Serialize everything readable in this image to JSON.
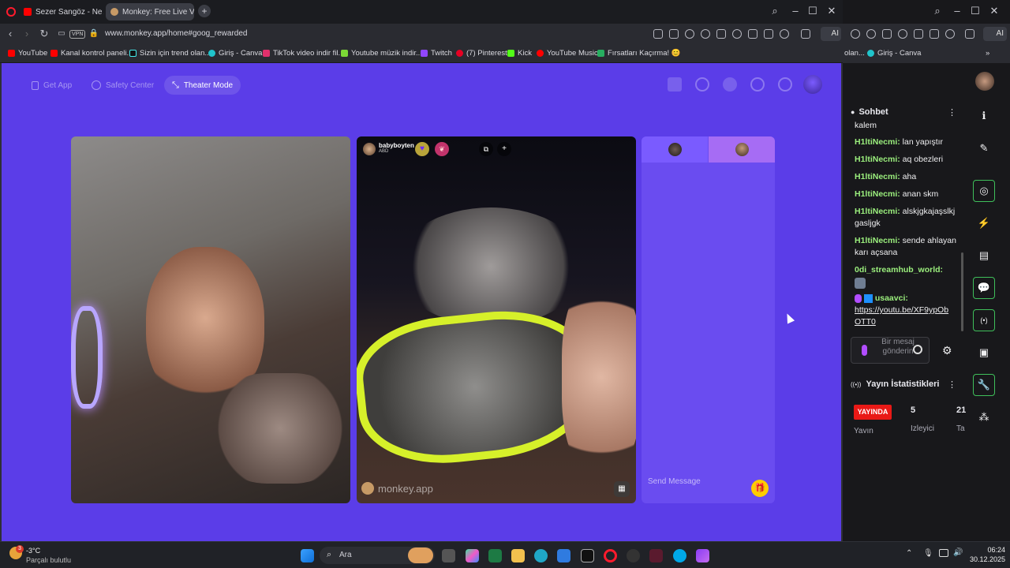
{
  "browser": {
    "tabs": [
      {
        "title": "Sezer Sangöz - Ne Ay Ge..."
      },
      {
        "title": "Monkey: Free Live Vi..."
      }
    ],
    "url": "www.monkey.app/home#goog_rewarded",
    "vpn_label": "VPN",
    "ai_label": "AI",
    "bookmarks": [
      {
        "label": "YouTube"
      },
      {
        "label": "Kanal kontrol paneli..."
      },
      {
        "label": "Sizin için trend olan..."
      },
      {
        "label": "Giriş - Canva"
      },
      {
        "label": "TikTok video indir fil..."
      },
      {
        "label": "Youtube müzik indir..."
      },
      {
        "label": "Twitch"
      },
      {
        "label": "(7) Pinterest"
      },
      {
        "label": "Kick"
      },
      {
        "label": "YouTube Music"
      },
      {
        "label": "Fırsatları Kaçırma! 😊"
      }
    ]
  },
  "right_browser": {
    "bookmarks": [
      {
        "label": "olan..."
      },
      {
        "label": "Giriş - Canva"
      }
    ],
    "ai_label": "AI"
  },
  "monkey": {
    "get_app": "Get App",
    "safety_center": "Safety Center",
    "theater_mode": "Theater Mode",
    "remote_user": {
      "name": "babyboyten",
      "country": "ABD"
    },
    "watermark": "monkey.app",
    "send_message_placeholder": "Send Message"
  },
  "twitch": {
    "chat_title": "Sohbet",
    "messages": [
      {
        "user": "",
        "text": "kalem"
      },
      {
        "user": "H1ltiNecmi:",
        "text": " lan yapıştır"
      },
      {
        "user": "H1ltiNecmi:",
        "text": " aq obezleri"
      },
      {
        "user": "H1ltiNecmi:",
        "text": " aha"
      },
      {
        "user": "H1ltiNecmi:",
        "text": " anan skm"
      },
      {
        "user": "H1ltiNecmi:",
        "text": " alskjgkajaşslkjgasljgk"
      },
      {
        "user": "H1ltiNecmi:",
        "text": " sende ahlayan karı açsana"
      },
      {
        "user": "0di_streamhub_world:",
        "text": ""
      },
      {
        "user": "usaavci:",
        "text": ""
      }
    ],
    "link": "https://youtu.be/XF9ypObOTT0",
    "input_placeholder": "Bir mesaj gönderin",
    "stats_title": "Yayın İstatistikleri",
    "live_badge": "YAYINDA",
    "viewers_value": "5",
    "viewers_label": "İzleyici",
    "stat3_value": "21",
    "stat3_label": "Ta",
    "stat1_label": "Yayın"
  },
  "taskbar": {
    "weather_temp": "-3°C",
    "weather_desc": "Parçalı bulutlu",
    "weather_badge": "3",
    "search_label": "Ara",
    "time": "06:24",
    "date": "30.12.2025"
  },
  "colors": {
    "monkey_purple": "#5b3de8",
    "twitch_green": "#9bef7d",
    "live_red": "#e91916"
  }
}
